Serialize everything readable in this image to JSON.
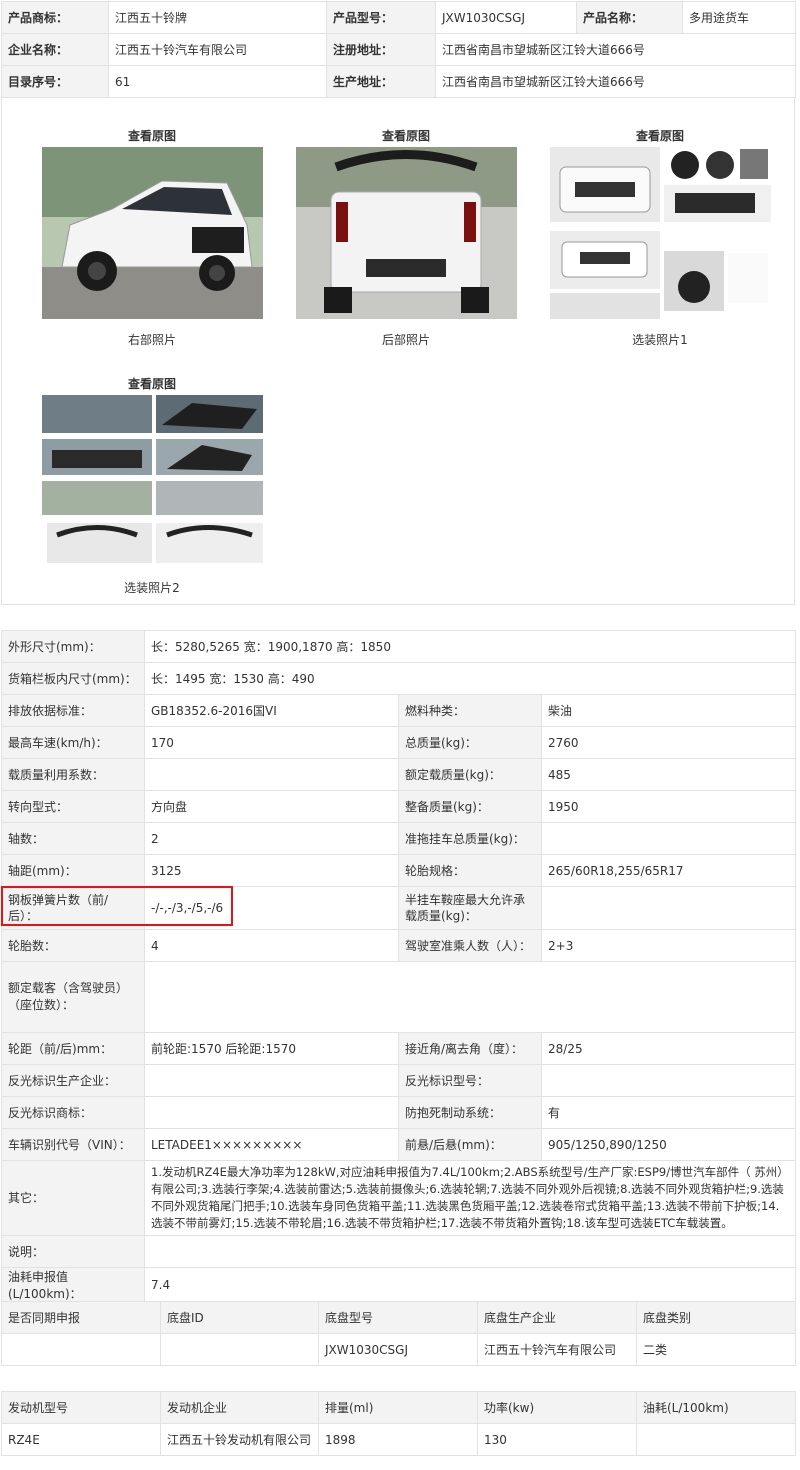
{
  "header": {
    "brand_label": "产品商标：",
    "brand": "江西五十铃牌",
    "model_label": "产品型号：",
    "model": "JXW1030CSGJ",
    "name_label": "产品名称：",
    "name": "多用途货车",
    "company_label": "企业名称：",
    "company": "江西五十铃汽车有限公司",
    "reg_addr_label": "注册地址：",
    "reg_addr": "江西省南昌市望城新区江铃大道666号",
    "catalog_label": "目录序号：",
    "catalog": "61",
    "prod_addr_label": "生产地址：",
    "prod_addr": "江西省南昌市望城新区江铃大道666号"
  },
  "photos": [
    {
      "top": "查看原图",
      "caption": "右部照片"
    },
    {
      "top": "查看原图",
      "caption": "后部照片"
    },
    {
      "top": "查看原图",
      "caption": "选装照片1"
    },
    {
      "top": "查看原图",
      "caption": "选装照片2"
    }
  ],
  "specs": {
    "dims_label": "外形尺寸(mm)：",
    "dims": "长：5280,5265 宽：1900,1870 高：1850",
    "cargo_label": "货箱栏板内尺寸(mm)：",
    "cargo": "长：1495 宽：1530 高：490",
    "emission_label": "排放依据标准：",
    "emission": "GB18352.6-2016国VI",
    "fuel_label": "燃料种类：",
    "fuel": "柴油",
    "speed_label": "最高车速(km/h)：",
    "speed": "170",
    "total_mass_label": "总质量(kg)：",
    "total_mass": "2760",
    "load_util_label": "载质量利用系数：",
    "load_util": "",
    "rated_load_label": "额定载质量(kg)：",
    "rated_load": "485",
    "steering_label": "转向型式：",
    "steering": "方向盘",
    "curb_label": "整备质量(kg)：",
    "curb": "1950",
    "axles_label": "轴数：",
    "axles": "2",
    "tow_label": "准拖挂车总质量(kg)：",
    "tow": "",
    "wheelbase_label": "轴距(mm)：",
    "wheelbase": "3125",
    "tire_spec_label": "轮胎规格：",
    "tire_spec": "265/60R18,255/65R17",
    "springs_label": "钢板弹簧片数（前/后）：",
    "springs": "-/-,-/3,-/5,-/6",
    "saddle_label": "半挂车鞍座最大允许承载质量(kg)：",
    "saddle": "",
    "tires_label": "轮胎数：",
    "tires": "4",
    "cab_label": "驾驶室准乘人数（人）：",
    "cab": "2+3",
    "passengers_label": "额定载客（含驾驶员）（座位数）：",
    "passengers": "",
    "track_label": "轮距（前/后)mm：",
    "track": "前轮距:1570 后轮距:1570",
    "angle_label": "接近角/离去角（度）：",
    "angle": "28/25",
    "refl_maker_label": "反光标识生产企业：",
    "refl_maker": "",
    "refl_model_label": "反光标识型号：",
    "refl_model": "",
    "refl_brand_label": "反光标识商标：",
    "refl_brand": "",
    "abs_label": "防抱死制动系统：",
    "abs": "有",
    "vin_label": "车辆识别代号（VIN）：",
    "vin": "LETADEE1×××××××××",
    "overhang_label": "前悬/后悬(mm)：",
    "overhang": "905/1250,890/1250",
    "other_label": "其它：",
    "other": "1.发动机RZ4E最大净功率为128kW,对应油耗申报值为7.4L/100km;2.ABS系统型号/生产厂家:ESP9/博世汽车部件（ 苏州）有限公司;3.选装行李架;4.选装前雷达;5.选装前摄像头;6.选装轮辋;7.选装不同外观外后视镜;8.选装不同外观货箱护栏;9.选装不同外观货箱尾门把手;10.选装车身同色货箱平盖;11.选装黑色货厢平盖;12.选装卷帘式货箱平盖;13.选装不带前下护板;14.选装不带前雾灯;15.选装不带轮眉;16.选装不带货箱护栏;17.选装不带货箱外置钩;18.该车型可选装ETC车载装置。",
    "note_label": "说明：",
    "note": "",
    "consumption_label": "油耗申报值(L/100km)：",
    "consumption": "7.4"
  },
  "chassis": {
    "headers": [
      "是否同期申报",
      "底盘ID",
      "底盘型号",
      "底盘生产企业",
      "底盘类别"
    ],
    "row": [
      "",
      "",
      "JXW1030CSGJ",
      "江西五十铃汽车有限公司",
      "二类"
    ]
  },
  "engine": {
    "headers": [
      "发动机型号",
      "发动机企业",
      "排量(ml)",
      "功率(kw)",
      "油耗(L/100km)"
    ],
    "row": [
      "RZ4E",
      "江西五十铃发动机有限公司",
      "1898",
      "130",
      ""
    ]
  },
  "colors": {
    "highlight": "#ee1111",
    "label_bg": "#f3f3f3",
    "border": "#e2e2e2"
  }
}
